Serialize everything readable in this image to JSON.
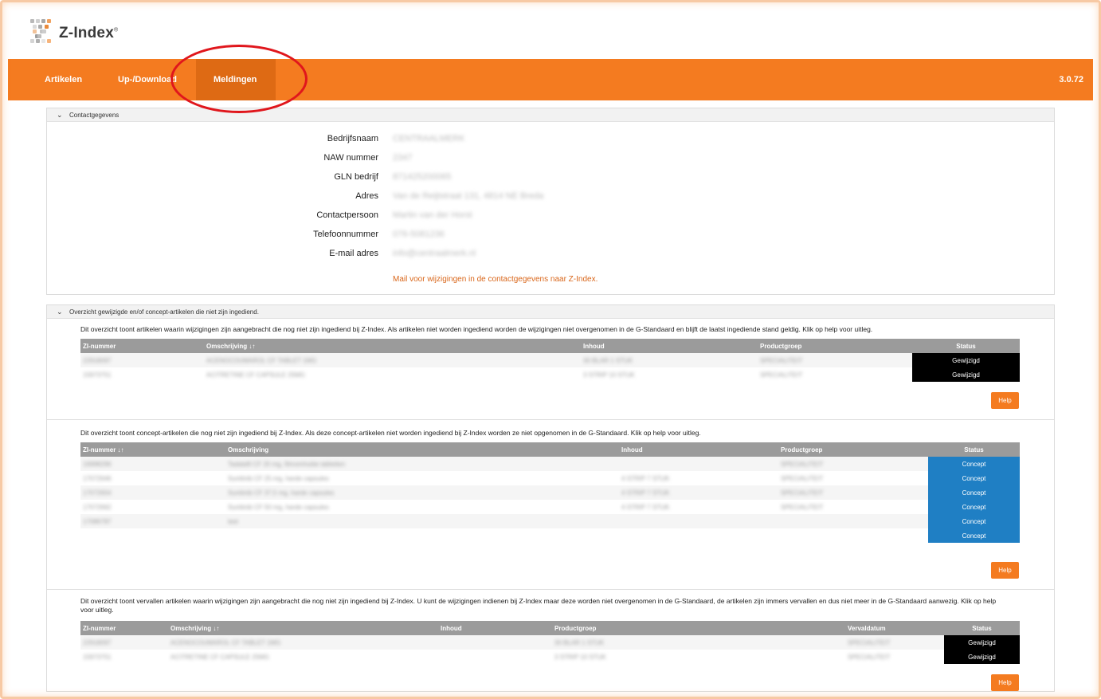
{
  "brand": {
    "name": "Z-Index",
    "reg": "®"
  },
  "nav": {
    "items": [
      {
        "label": "Artikelen"
      },
      {
        "label": "Up-/Download"
      },
      {
        "label": "Meldingen"
      }
    ],
    "active": "Meldingen",
    "version": "3.0.72"
  },
  "contact": {
    "section_title": "Contactgegevens",
    "fields": [
      {
        "label": "Bedrijfsnaam",
        "value": "CENTRAALMERK"
      },
      {
        "label": "NAW nummer",
        "value": "2347"
      },
      {
        "label": "GLN bedrijf",
        "value": "871425200065"
      },
      {
        "label": "Adres",
        "value": "Van de Reijtstraat 131, 4814 NE Breda"
      },
      {
        "label": "Contactpersoon",
        "value": "Martin van der Horst"
      },
      {
        "label": "Telefoonnummer",
        "value": "076-5081236"
      },
      {
        "label": "E-mail adres",
        "value": "info@centraalmerk.nl"
      }
    ],
    "mail_link": "Mail voor wijzigingen in de contactgegevens naar Z-Index."
  },
  "overview": {
    "section_title": "Overzicht gewijzigde en/of concept-artikelen die niet zijn ingediend.",
    "changed": {
      "description": "Dit overzicht toont artikelen waarin wijzigingen zijn aangebracht die nog niet zijn ingediend bij Z-Index. Als artikelen niet worden ingediend worden de wijzigingen niet overgenomen in de G-Standaard en blijft de laatst ingediende stand geldig. Klik op help voor uitleg.",
      "columns": [
        "ZI-nummer",
        "Omschrijving ↓↑",
        "Inhoud",
        "Productgroep",
        "Status"
      ],
      "rows": [
        [
          "22918097",
          "ACENOCOUMAROL CF TABLET 1MG",
          "30 BLAR 1 STUK",
          "SPECIALITEIT",
          "Gewijzigd"
        ],
        [
          "15973751",
          "ACITRETINE CF CAPSULE 25MG",
          "3 STRIP 10 STUK",
          "SPECIALITEIT",
          "Gewijzigd"
        ]
      ],
      "help": "Help"
    },
    "concept": {
      "description": "Dit overzicht toont concept-artikelen die nog niet zijn ingediend bij Z-Index. Als deze concept-artikelen niet worden ingediend bij Z-Index worden ze niet opgenomen in de G-Standaard. Klik op help voor uitleg.",
      "columns": [
        "ZI-nummer ↓↑",
        "Omschrijving",
        "Inhoud",
        "Productgroep",
        "Status"
      ],
      "rows": [
        [
          "16998296",
          "Tadalafil CF 20 mg, filmomhulde tabletten",
          "",
          "SPECIALITEIT",
          "Concept"
        ],
        [
          "17072646",
          "Sunitinib CF 25 mg, harde capsules",
          "4 STRIP 7 STUK",
          "SPECIALITEIT",
          "Concept"
        ],
        [
          "17072654",
          "Sunitinib CF 37,5 mg, harde capsules",
          "4 STRIP 7 STUK",
          "SPECIALITEIT",
          "Concept"
        ],
        [
          "17072662",
          "Sunitinib CF 50 mg, harde capsules",
          "4 STRIP 7 STUK",
          "SPECIALITEIT",
          "Concept"
        ],
        [
          "17086787",
          "test",
          "",
          "",
          "Concept"
        ],
        [
          "",
          "",
          "",
          "",
          "Concept"
        ]
      ],
      "help": "Help"
    },
    "expired": {
      "description": "Dit overzicht toont vervallen artikelen waarin wijzigingen zijn aangebracht die nog niet zijn ingediend bij Z-Index. U kunt de wijzigingen indienen bij Z-Index maar deze worden niet overgenomen in de G-Standaard, de artikelen zijn immers vervallen en dus niet meer in de G-Standaard aanwezig. Klik op help voor uitleg.",
      "columns": [
        "ZI-nummer",
        "Omschrijving ↓↑",
        "Inhoud",
        "Productgroep",
        "Vervaldatum",
        "Status"
      ],
      "rows": [
        [
          "22918097",
          "ACENOCOUMAROL CF TABLET 1MG",
          "",
          "30 BLAR 1 STUK",
          "SPECIALITEIT",
          "Gewijzigd"
        ],
        [
          "15973751",
          "ACITRETINE CF CAPSULE 25MG",
          "",
          "3 STRIP 10 STUK",
          "SPECIALITEIT",
          "Gewijzigd"
        ]
      ],
      "help": "Help"
    }
  },
  "colors": {
    "accent": "#f47b20",
    "accent_dark": "#de6a14",
    "concept": "#1f7fc4",
    "changed": "#000000",
    "annotation": "#e0161c"
  }
}
